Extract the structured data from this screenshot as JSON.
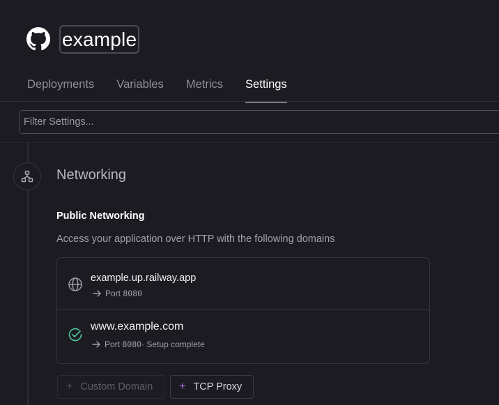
{
  "service": {
    "name": "example",
    "repo_icon": "github-icon"
  },
  "tabs": [
    {
      "label": "Deployments",
      "active": false
    },
    {
      "label": "Variables",
      "active": false
    },
    {
      "label": "Metrics",
      "active": false
    },
    {
      "label": "Settings",
      "active": true
    }
  ],
  "filter": {
    "placeholder": "Filter Settings...",
    "value": ""
  },
  "section": {
    "icon": "network-icon",
    "title": "Networking",
    "public": {
      "title": "Public Networking",
      "description": "Access your application over HTTP with the following domains"
    }
  },
  "domains": [
    {
      "icon": "globe-icon",
      "name": "example.up.railway.app",
      "port_prefix": "Port ",
      "port": "8080",
      "status": ""
    },
    {
      "icon": "check-circle-icon",
      "name": "www.example.com",
      "port_prefix": "Port ",
      "port": "8080",
      "status": " · Setup complete"
    }
  ],
  "buttons": {
    "custom_domain": "Custom Domain",
    "tcp_proxy": "TCP Proxy"
  },
  "colors": {
    "background": "#1c1b22",
    "accent_purple": "#a76cf2",
    "success_green": "#4fc79a"
  }
}
